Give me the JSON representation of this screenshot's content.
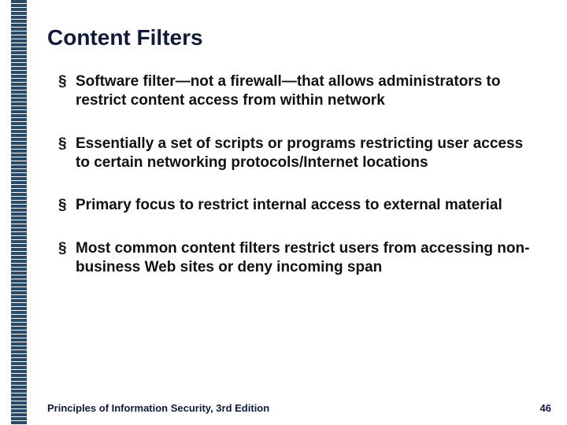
{
  "slide": {
    "title": "Content Filters",
    "bullets": [
      "Software filter—not a firewall—that allows administrators to restrict content access from within network",
      "Essentially a set of scripts or programs restricting user access to certain networking protocols/Internet locations",
      "Primary focus to restrict internal access to external material",
      "Most common content filters restrict users from accessing non-business Web sites or deny incoming span"
    ],
    "footer": "Principles of Information Security, 3rd Edition",
    "page": "46"
  }
}
